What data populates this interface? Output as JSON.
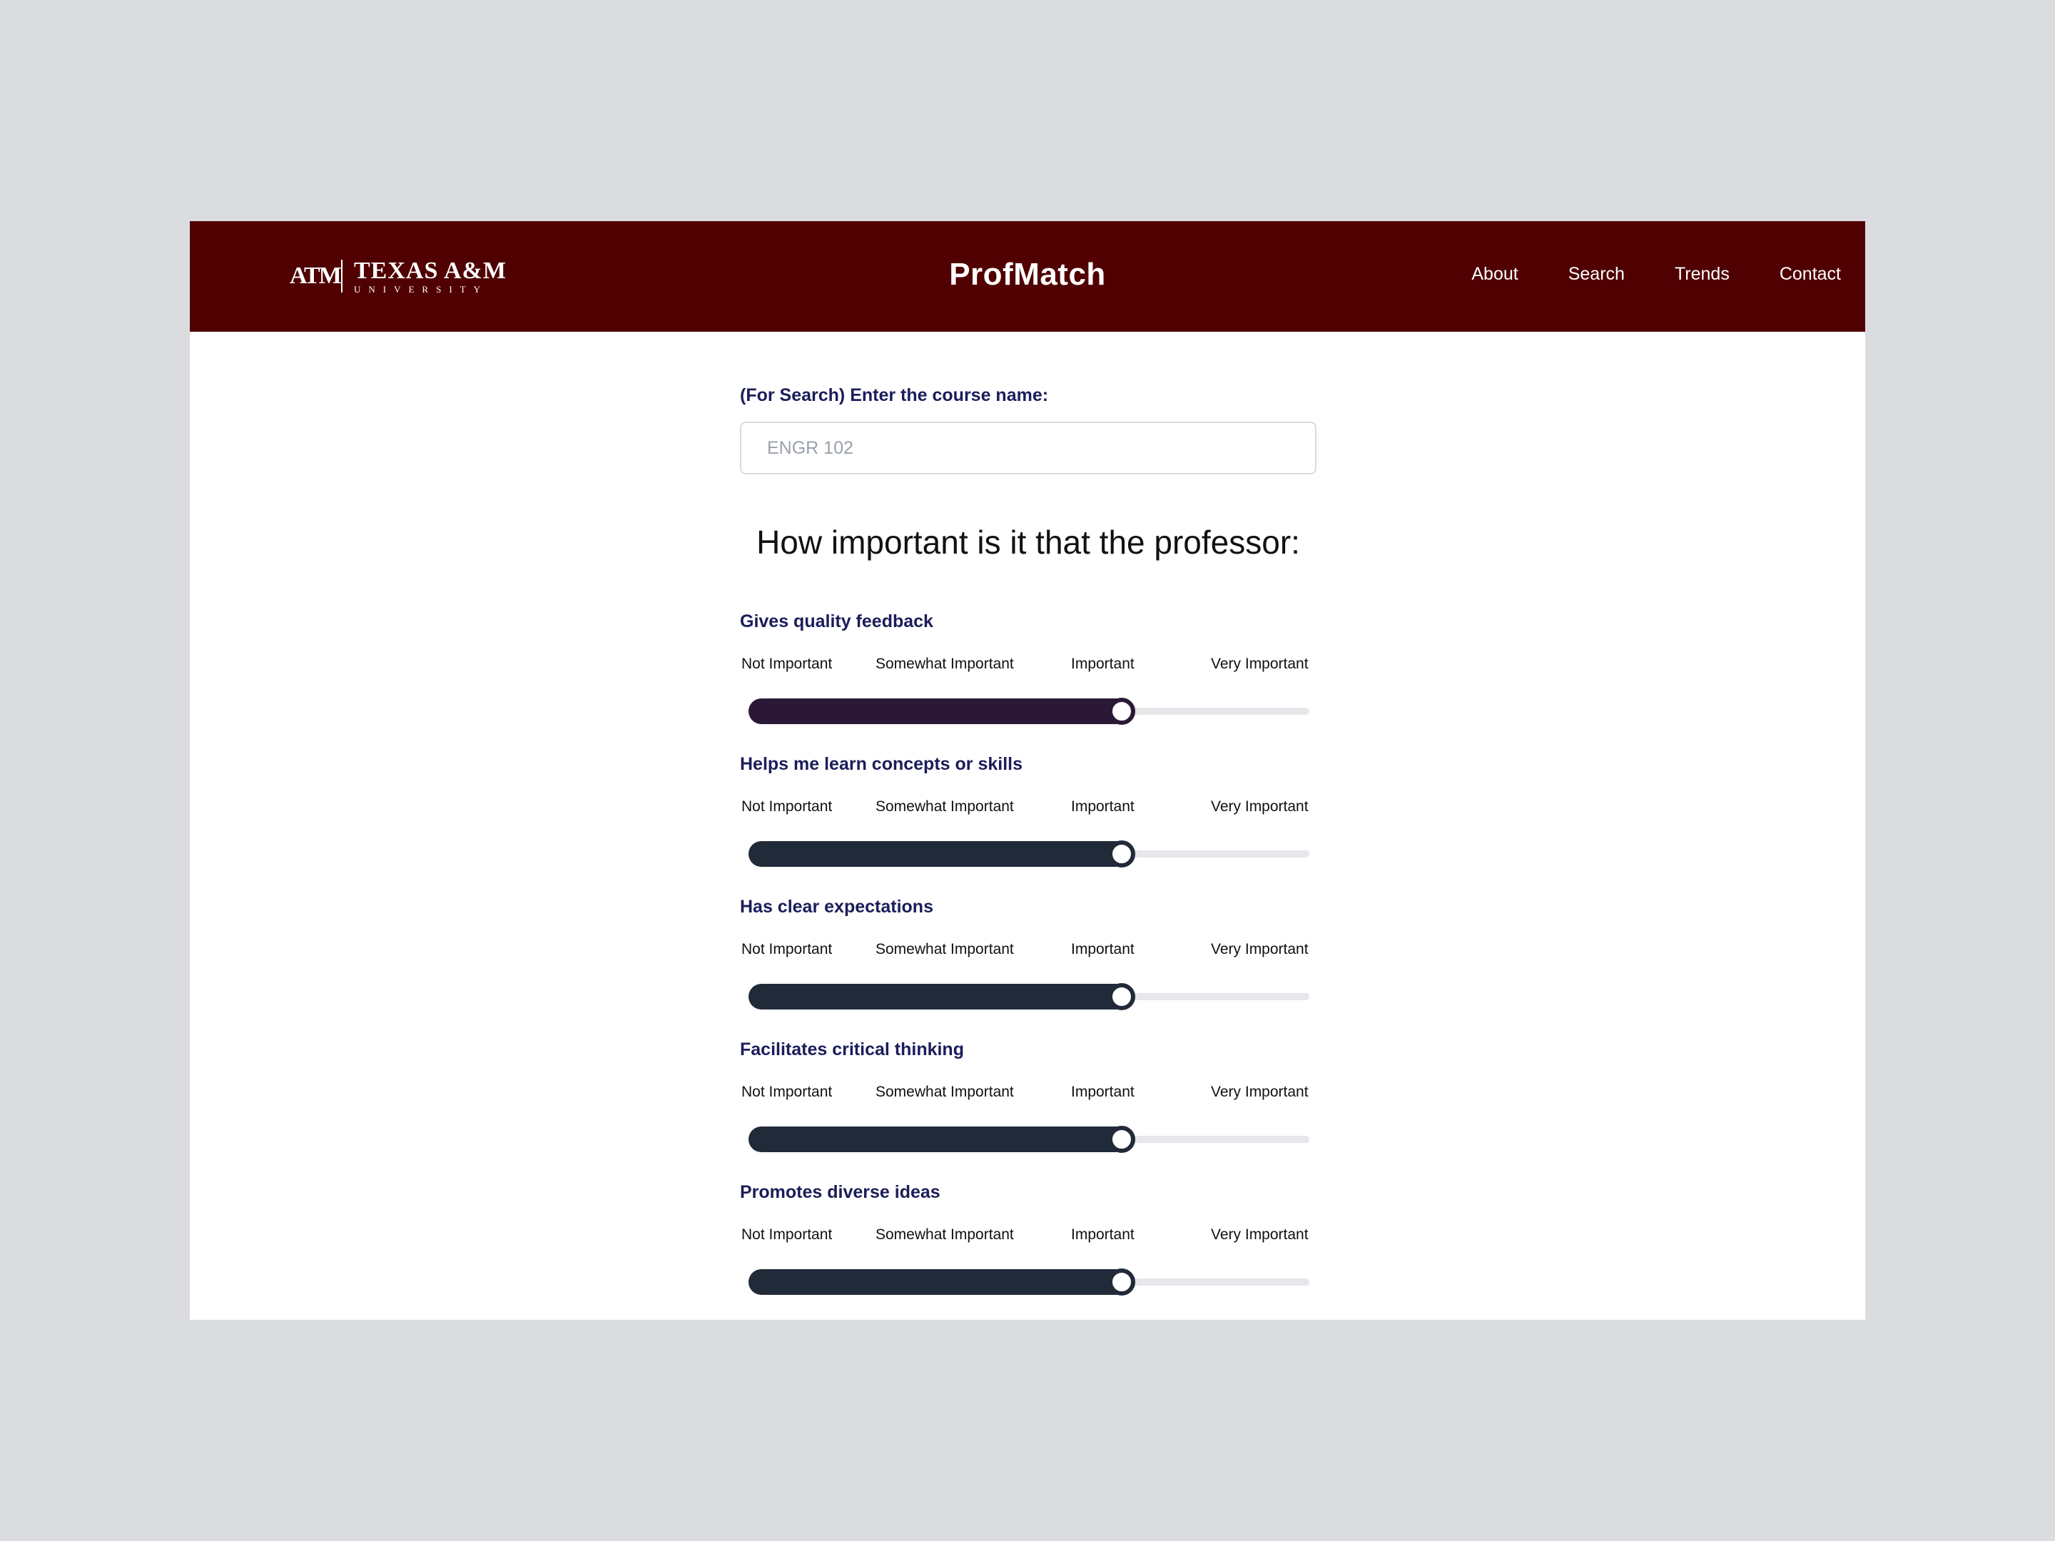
{
  "header": {
    "logo": {
      "mark": "ATM",
      "top": "TEXAS A&M",
      "bottom": "UNIVERSITY"
    },
    "brand": "ProfMatch",
    "nav": [
      "About",
      "Search",
      "Trends",
      "Contact"
    ],
    "background_color": "#500000"
  },
  "search": {
    "label": "(For Search) Enter the course name:",
    "placeholder": "ENGR 102",
    "value": ""
  },
  "question": "How important is it that the professor:",
  "scale_labels": [
    "Not Important",
    "Somewhat Important",
    "Important",
    "Very Important"
  ],
  "criteria": [
    {
      "title": "Gives quality feedback",
      "level_fraction": 0.665,
      "level_label": "Important"
    },
    {
      "title": "Helps me learn concepts or skills",
      "level_fraction": 0.665,
      "level_label": "Important"
    },
    {
      "title": "Has clear expectations",
      "level_fraction": 0.665,
      "level_label": "Important"
    },
    {
      "title": "Facilitates critical thinking",
      "level_fraction": 0.665,
      "level_label": "Important"
    },
    {
      "title": "Promotes diverse ideas",
      "level_fraction": 0.665,
      "level_label": "Important"
    }
  ],
  "colors": {
    "page_background": "#dbdce0",
    "label_text": "#1b1d5a",
    "slider_fill": "#212a38",
    "slider_fill_first": "#2b1836",
    "slider_track": "#e6e7ea"
  }
}
